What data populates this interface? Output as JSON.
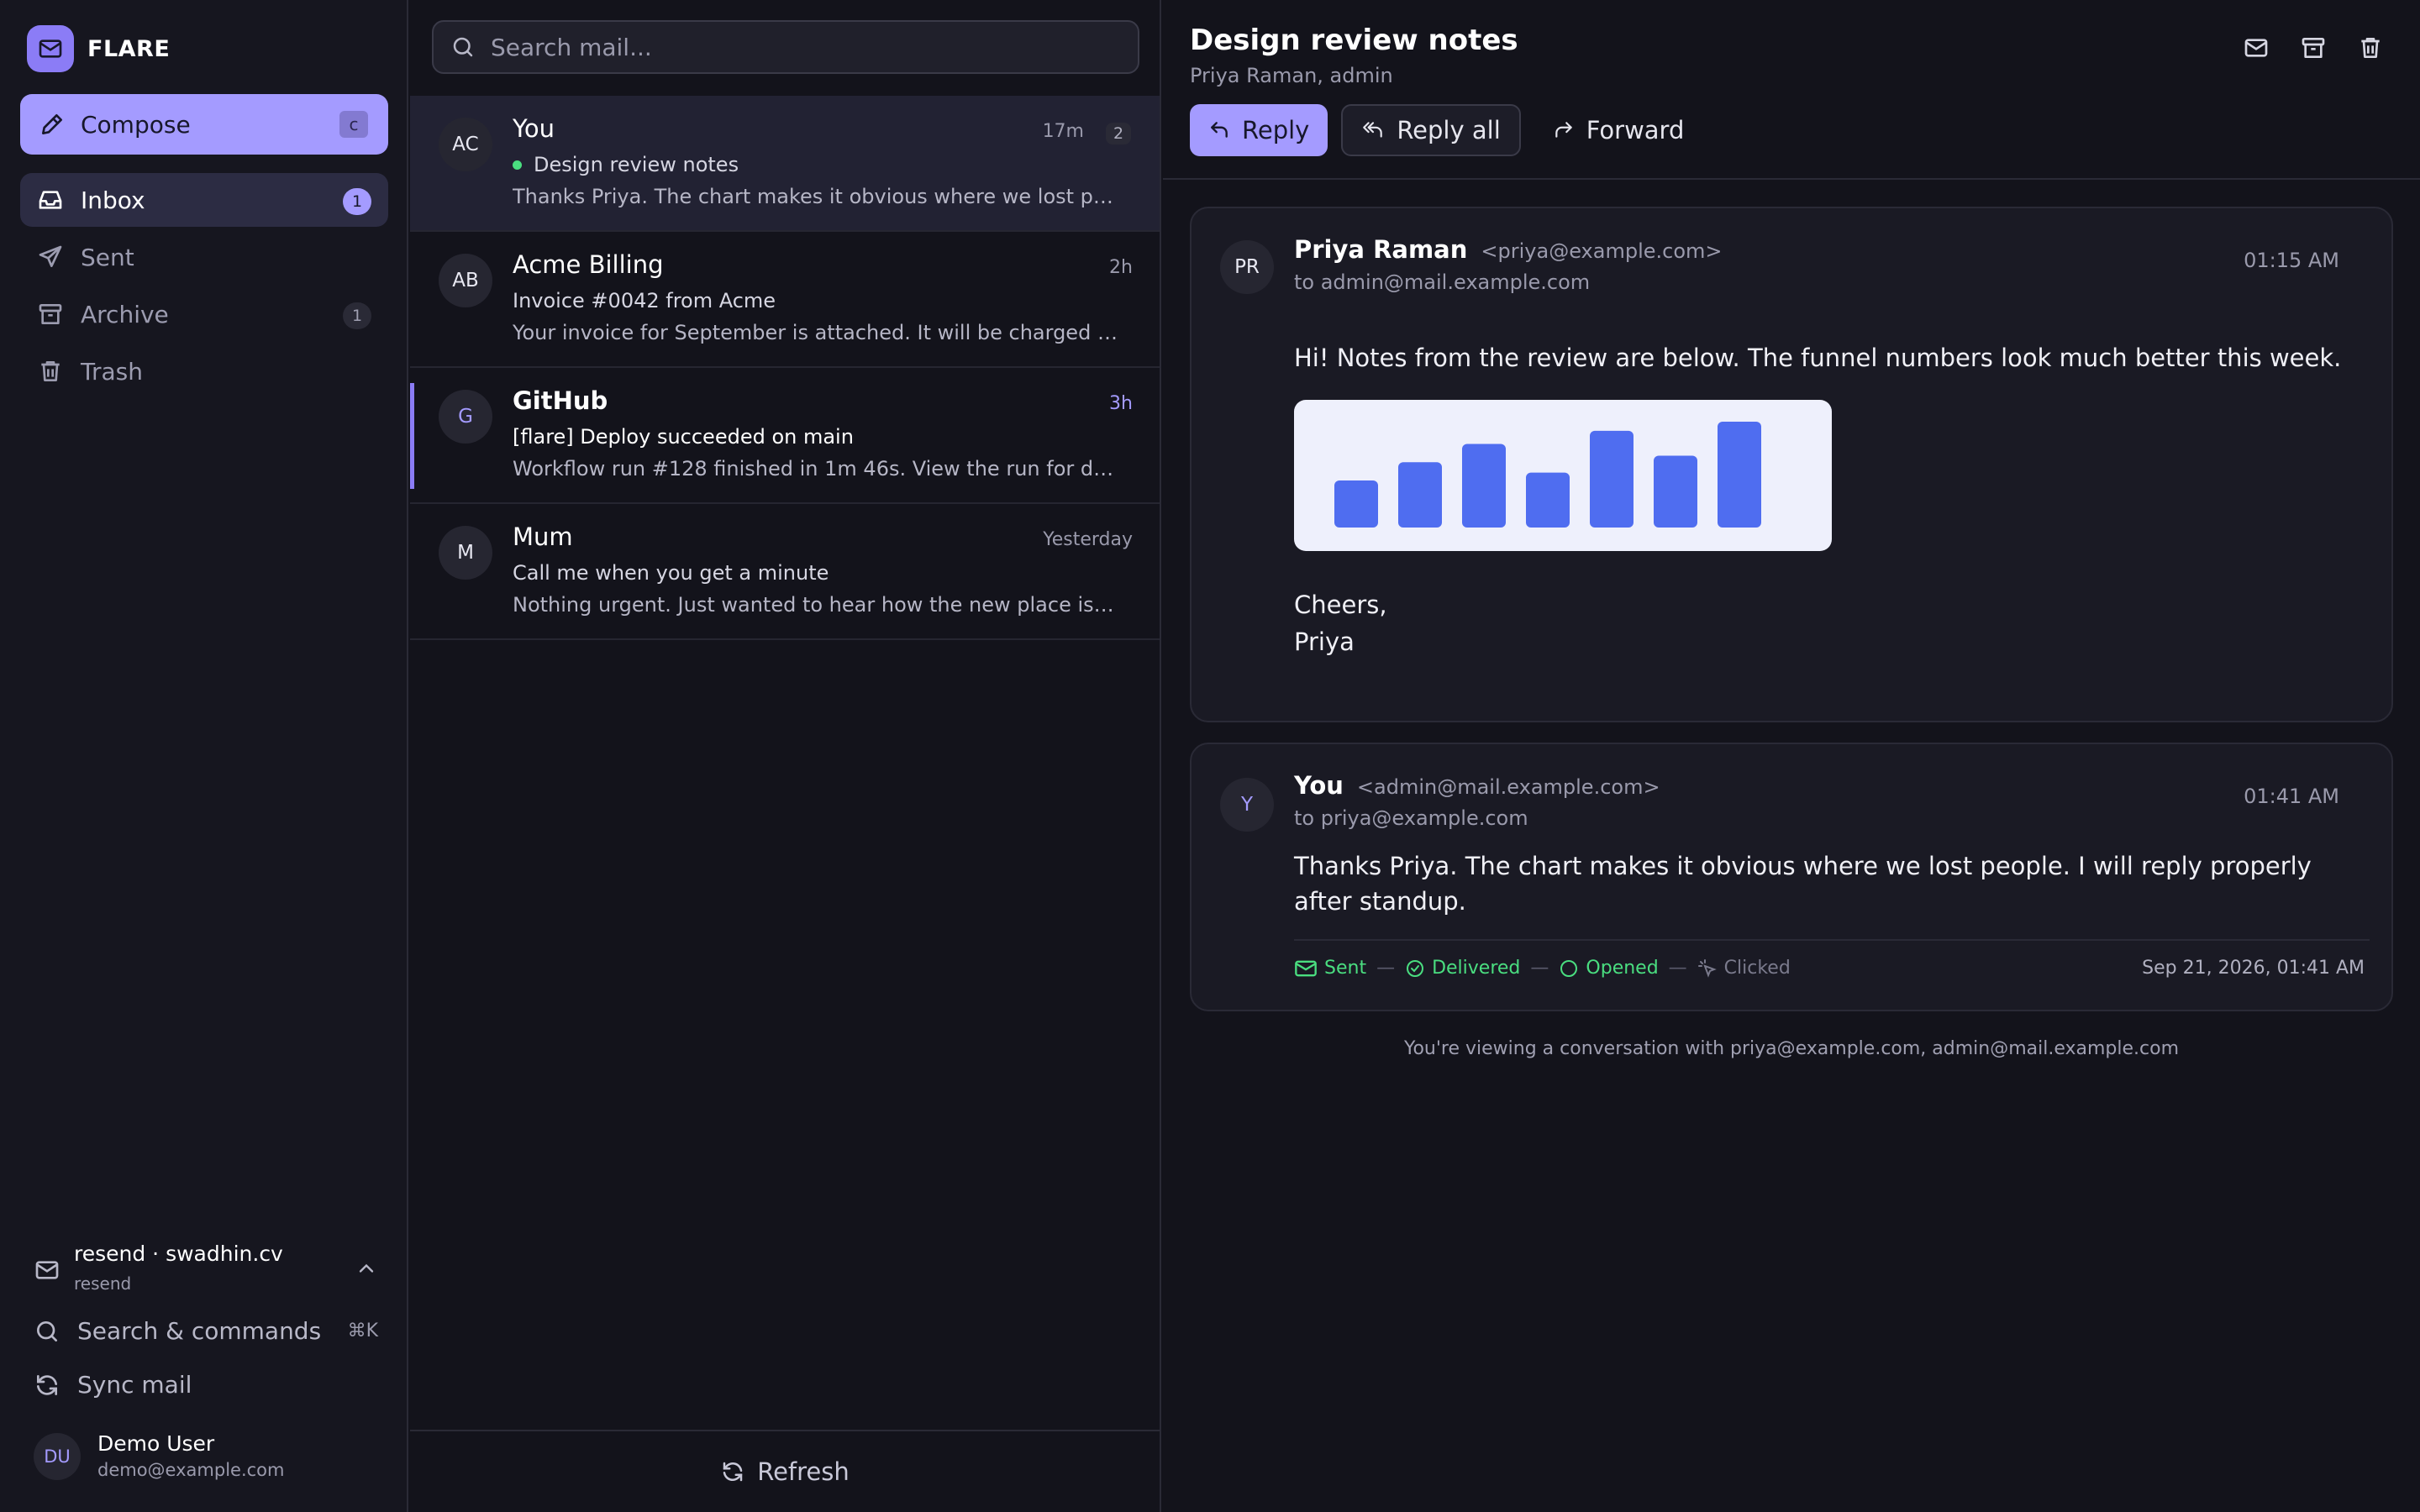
{
  "app": {
    "name": "FLARE"
  },
  "sidebar": {
    "compose": {
      "label": "Compose",
      "shortcut": "c"
    },
    "items": [
      {
        "label": "Inbox",
        "badge": "1",
        "active": true,
        "icon": "inbox-icon"
      },
      {
        "label": "Sent",
        "badge": "",
        "active": false,
        "icon": "send-icon"
      },
      {
        "label": "Archive",
        "badge": "1",
        "active": false,
        "icon": "archive-icon"
      },
      {
        "label": "Trash",
        "badge": "",
        "active": false,
        "icon": "trash-icon"
      }
    ],
    "account": {
      "name": "resend · swadhin.cv",
      "provider": "resend"
    },
    "search_commands": {
      "label": "Search & commands",
      "shortcut": "⌘K"
    },
    "sync": {
      "label": "Sync mail"
    },
    "user": {
      "initials": "DU",
      "name": "Demo User",
      "email": "demo@example.com"
    }
  },
  "list": {
    "search_placeholder": "Search mail...",
    "items": [
      {
        "initials": "AC",
        "sender": "You",
        "time": "17m",
        "count": "2",
        "subject": "Design review notes",
        "preview": "Thanks Priya. The chart makes it obvious where we lost people. I will reply properly after standup.",
        "selected": true,
        "unread": false
      },
      {
        "initials": "AB",
        "sender": "Acme Billing",
        "time": "2h",
        "count": "",
        "subject": "Invoice #0042 from Acme",
        "preview": "Your invoice for September is attached. It will be charged to the card on file.",
        "selected": false,
        "unread": false
      },
      {
        "initials": "G",
        "sender": "GitHub",
        "time": "3h",
        "count": "",
        "subject": "[flare] Deploy succeeded on main",
        "preview": "Workflow run #128 finished in 1m 46s. View the run for details.",
        "selected": false,
        "unread": true
      },
      {
        "initials": "M",
        "sender": "Mum",
        "time": "Yesterday",
        "count": "",
        "subject": "Call me when you get a minute",
        "preview": "Nothing urgent. Just wanted to hear how the new place is coming along.",
        "selected": false,
        "unread": false
      }
    ],
    "refresh_label": "Refresh"
  },
  "thread": {
    "subject": "Design review notes",
    "participants": "Priya Raman, admin",
    "actions": {
      "reply": "Reply",
      "reply_all": "Reply all",
      "forward": "Forward"
    },
    "messages": [
      {
        "initials": "PR",
        "name": "Priya Raman",
        "address": "<priya@example.com>",
        "to": "to admin@mail.example.com",
        "time": "01:15 AM",
        "body": "Hi! Notes from the review are below. The funnel numbers look much better this week.",
        "signoff": "Cheers,",
        "signature": "Priya"
      },
      {
        "initials": "Y",
        "name": "You",
        "address": "<admin@mail.example.com>",
        "to": "to priya@example.com",
        "time": "01:41 AM",
        "body": "Thanks Priya. The chart makes it obvious where we lost people. I will reply properly after standup.",
        "tracking": {
          "sent": "Sent",
          "delivered": "Delivered",
          "opened": "Opened",
          "clicked": "Clicked",
          "date": "Sep 21, 2026, 01:41 AM"
        }
      }
    ],
    "note": "You're viewing a conversation with priya@example.com, admin@mail.example.com"
  },
  "chart_data": {
    "type": "bar",
    "values": [
      36,
      50,
      64,
      42,
      74,
      55,
      81
    ],
    "ylim": [
      0,
      90
    ],
    "bar_color": "#4f6df0",
    "background": "#eef0fc"
  },
  "colors": {
    "accent": "#a49bff",
    "success": "#4ade80",
    "background": "#13131b"
  }
}
